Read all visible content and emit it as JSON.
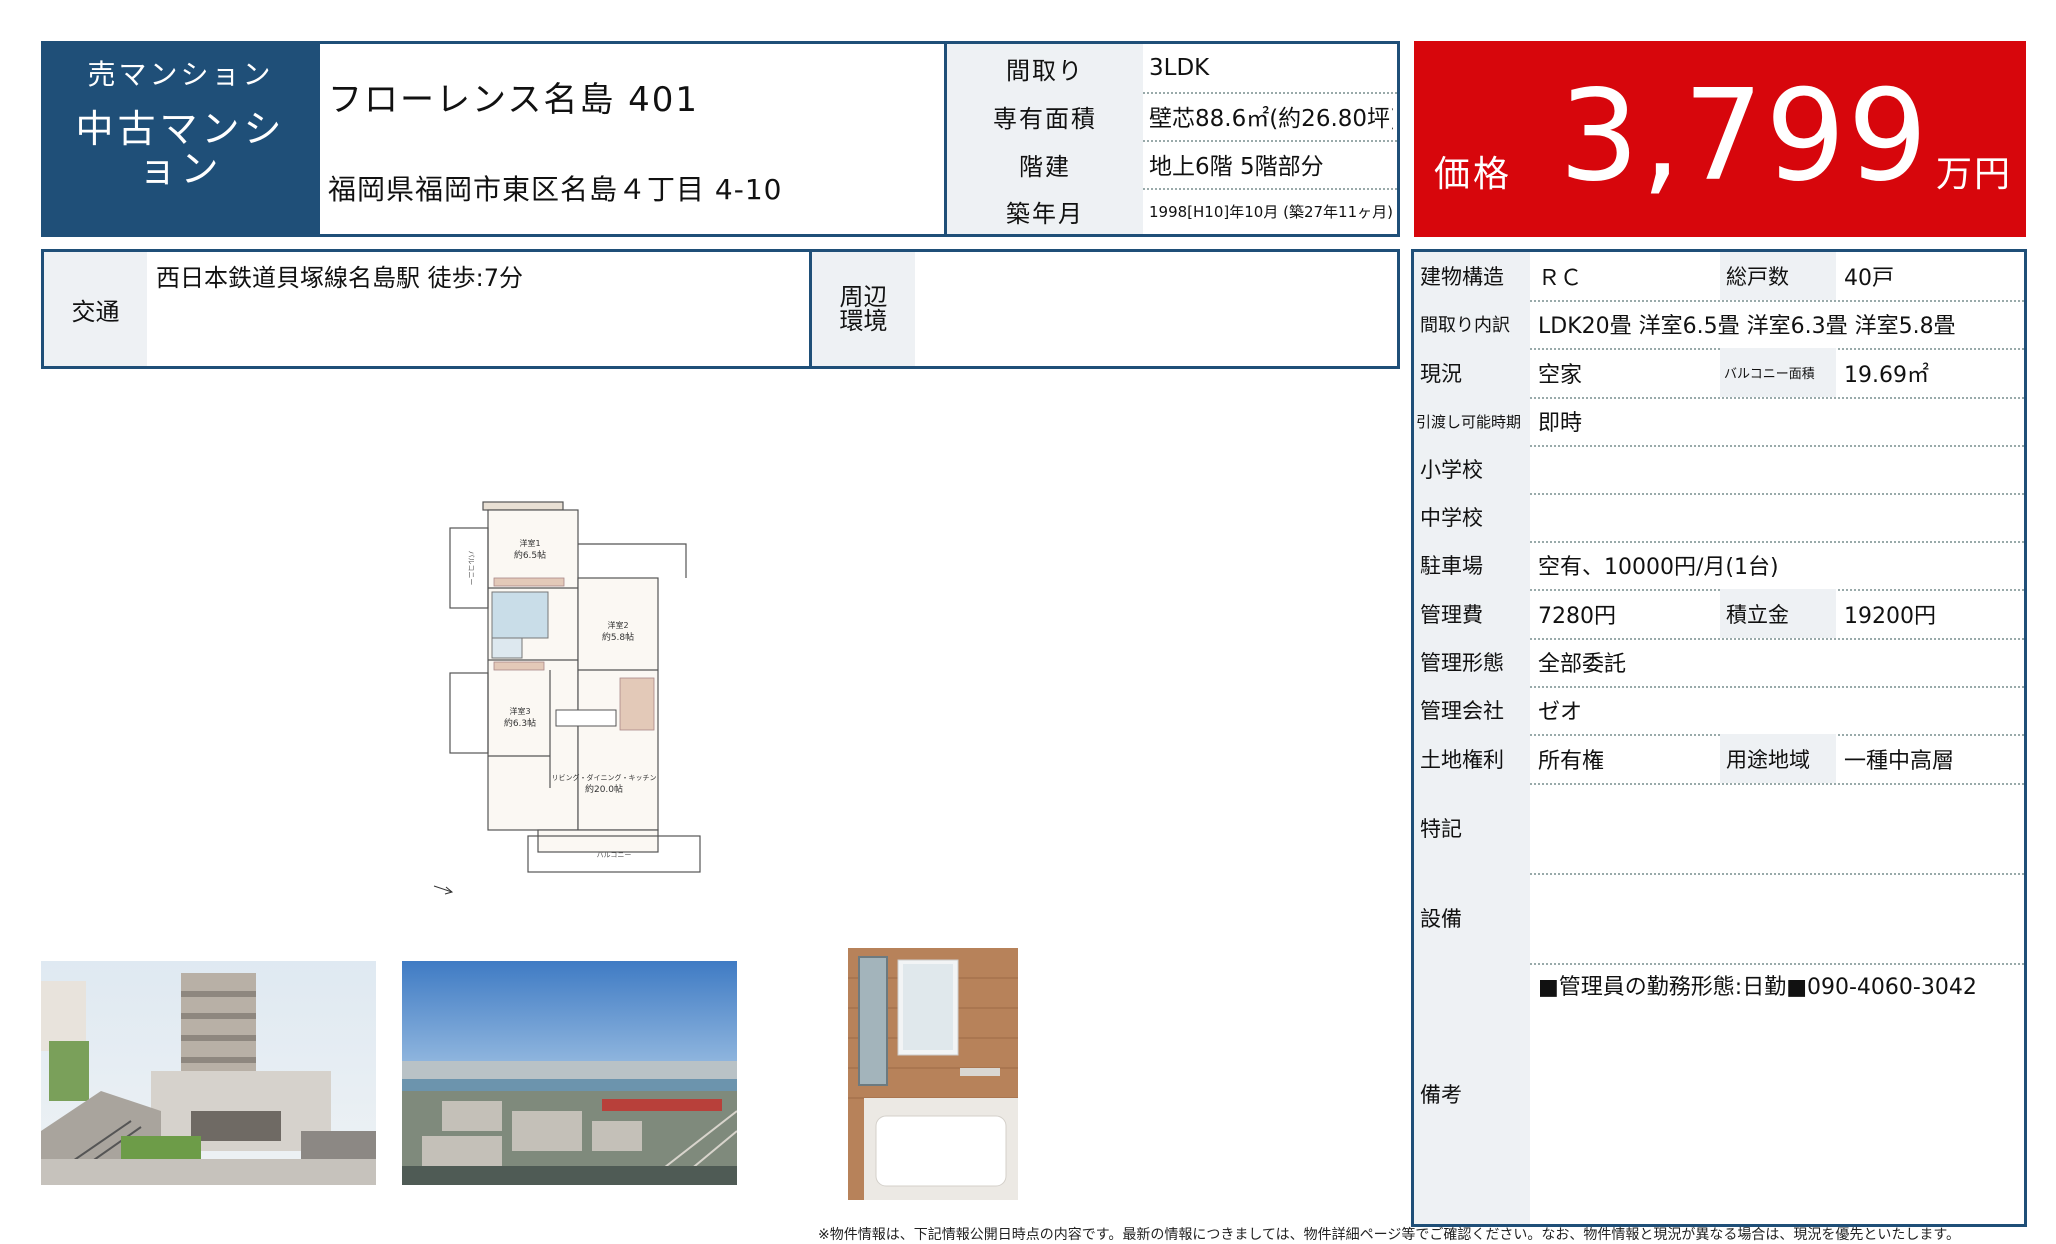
{
  "header": {
    "type_sub": "売マンション",
    "type_main": "中古マンション",
    "property_name": "フローレンス名島 401",
    "address": "福岡県福岡市東区名島４丁目 4-10"
  },
  "top_specs": [
    {
      "label": "間取り",
      "value": "3LDK"
    },
    {
      "label": "専有面積",
      "value": "壁芯88.6㎡(約26.80坪)"
    },
    {
      "label": "階建",
      "value": "地上6階 5階部分"
    },
    {
      "label": "築年月",
      "value": "1998[H10]年10月 (築27年11ヶ月)"
    }
  ],
  "price": {
    "label": "価格",
    "value": "3,799",
    "unit": "万円"
  },
  "access": {
    "label": "交通",
    "value": "西日本鉄道貝塚線名島駅 徒歩:7分",
    "env_label": "周辺環境",
    "env_value": ""
  },
  "details": {
    "structure_label": "建物構造",
    "structure": "ＲＣ",
    "units_label": "総戸数",
    "units": "40戸",
    "rooms_label": "間取り内訳",
    "rooms": "LDK20畳 洋室6.5畳 洋室6.3畳 洋室5.8畳",
    "status_label": "現況",
    "status": "空家",
    "balcony_label": "バルコニー面積",
    "balcony": "19.69㎡",
    "handover_label": "引渡し可能時期",
    "handover": "即時",
    "elementary_label": "小学校",
    "elementary": "",
    "junior_label": "中学校",
    "junior": "",
    "parking_label": "駐車場",
    "parking": "空有、10000円/月(1台)",
    "mgmt_fee_label": "管理費",
    "mgmt_fee": "7280円",
    "reserve_label": "積立金",
    "reserve": "19200円",
    "mgmt_type_label": "管理形態",
    "mgmt_type": "全部委託",
    "mgmt_company_label": "管理会社",
    "mgmt_company": "ゼオ",
    "land_label": "土地権利",
    "land": "所有権",
    "zoning_label": "用途地域",
    "zoning": "一種中高層",
    "notes_label": "特記",
    "notes": "",
    "equipment_label": "設備",
    "equipment": "",
    "remarks_label": "備考",
    "remarks": "■管理員の勤務形態:日勤■090-4060-3042"
  },
  "floorplan": {
    "rooms": [
      {
        "name": "洋室1",
        "size": "約6.5帖"
      },
      {
        "name": "洋室2",
        "size": "約5.8帖"
      },
      {
        "name": "洋室3",
        "size": "約6.3帖"
      },
      {
        "name": "リビング・ダイニング・キッチン",
        "size": "約20.0帖"
      }
    ],
    "balcony_side": "バルコニー",
    "balcony_bottom": "バルコニー"
  },
  "footnote": "※物件情報は、下記情報公開日時点の内容です。最新の情報につきましては、物件詳細ページ等でご確認ください。なお、物件情報と現況が異なる場合は、現況を優先といたします。"
}
